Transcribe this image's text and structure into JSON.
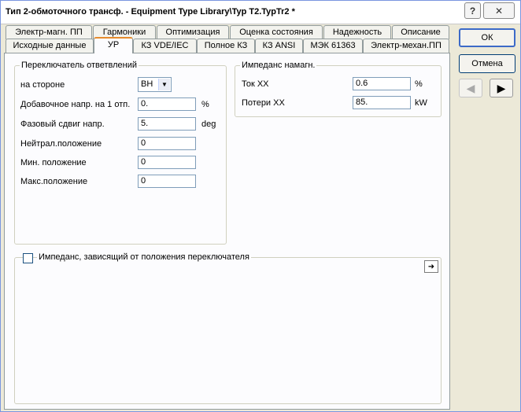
{
  "window": {
    "title": "Тип 2-обмоточного трансф. - Equipment Type Library\\Typ T2.TypTr2 *",
    "help_label": "?",
    "close_label": "✕"
  },
  "tabs_row1": [
    {
      "label": "Электр-магн. ПП"
    },
    {
      "label": "Гармоники"
    },
    {
      "label": "Оптимизация"
    },
    {
      "label": "Оценка состояния"
    },
    {
      "label": "Надежность"
    },
    {
      "label": "Описание"
    }
  ],
  "tabs_row2": [
    {
      "label": "Исходные данные"
    },
    {
      "label": "УР"
    },
    {
      "label": "КЗ VDE/IEC"
    },
    {
      "label": "Полное КЗ"
    },
    {
      "label": "КЗ ANSI"
    },
    {
      "label": "МЭК 61363"
    },
    {
      "label": "Электр-механ.ПП"
    }
  ],
  "tap_changer": {
    "title": "Переключатель ответвлений",
    "side_label": "на стороне",
    "side_value": "ВН",
    "add_voltage_label": "Добавочное напр. на 1 отп.",
    "add_voltage_value": "0.",
    "add_voltage_unit": "%",
    "phase_shift_label": "Фазовый сдвиг напр.",
    "phase_shift_value": "5.",
    "phase_shift_unit": "deg",
    "neutral_label": "Нейтрал.положение",
    "neutral_value": "0",
    "min_label": "Мин. положение",
    "min_value": "0",
    "max_label": "Макс.положение",
    "max_value": "0"
  },
  "magnetizing": {
    "title": "Импеданс намагн.",
    "current_label": "Ток ХХ",
    "current_value": "0.6",
    "current_unit": "%",
    "losses_label": "Потери ХХ",
    "losses_value": "85.",
    "losses_unit": "kW"
  },
  "tap_dependent": {
    "checkbox_label": "Импеданс, зависящий от положения переключателя",
    "checked": false,
    "arrow_label": "➜"
  },
  "buttons": {
    "ok_label": "ОК",
    "cancel_label": "Отмена",
    "prev_label": "◀",
    "next_label": "▶"
  }
}
